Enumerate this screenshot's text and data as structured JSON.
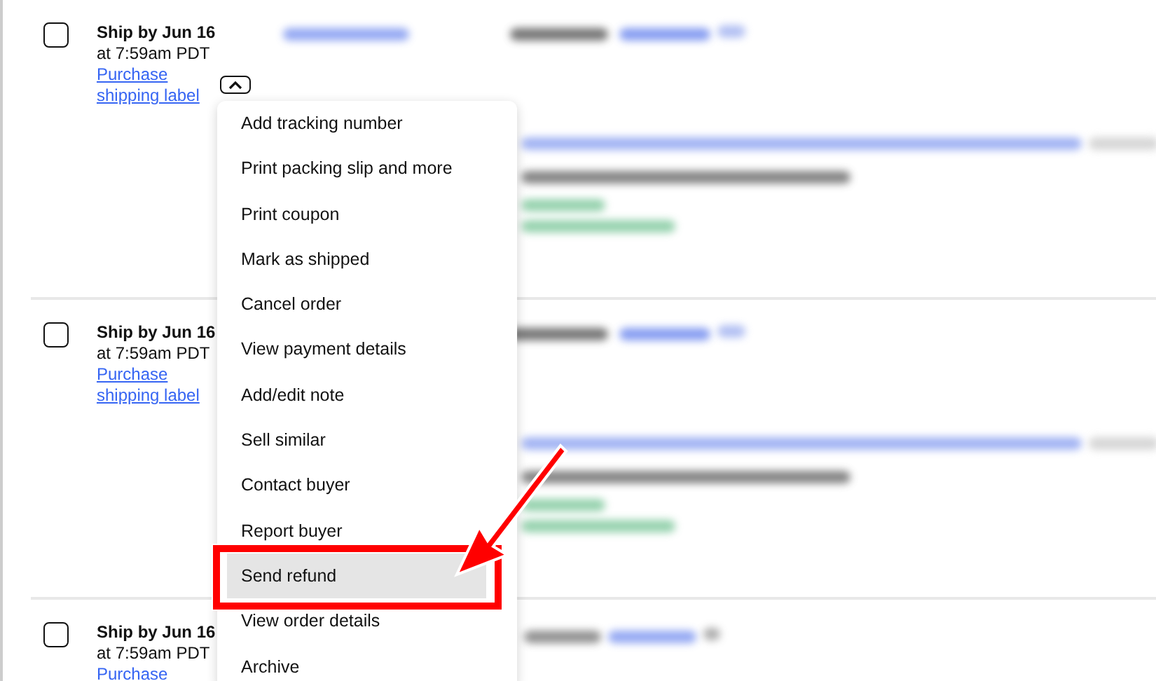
{
  "orders": [
    {
      "ship_by": "Ship by Jun 16",
      "time": "at 7:59am PDT",
      "link": "Purchase shipping label",
      "menu_open": true,
      "checked": false
    },
    {
      "ship_by": "Ship by Jun 16",
      "time": "at 7:59am PDT",
      "link": "Purchase shipping label",
      "menu_open": false,
      "checked": false
    },
    {
      "ship_by": "Ship by Jun 16",
      "time": "at 7:59am PDT",
      "link": "Purchase",
      "menu_open": false,
      "checked": false
    }
  ],
  "menu": [
    {
      "label": "Add tracking number",
      "selected": false
    },
    {
      "label": "Print packing slip and more",
      "selected": false
    },
    {
      "label": "Print coupon",
      "selected": false
    },
    {
      "label": "Mark as shipped",
      "selected": false
    },
    {
      "label": "Cancel order",
      "selected": false
    },
    {
      "label": "View payment details",
      "selected": false
    },
    {
      "label": "Add/edit note",
      "selected": false
    },
    {
      "label": "Sell similar",
      "selected": false
    },
    {
      "label": "Contact buyer",
      "selected": false
    },
    {
      "label": "Report buyer",
      "selected": false
    },
    {
      "label": "Send refund",
      "selected": true
    },
    {
      "label": "View order details",
      "selected": false
    },
    {
      "label": "Archive",
      "selected": false
    }
  ]
}
